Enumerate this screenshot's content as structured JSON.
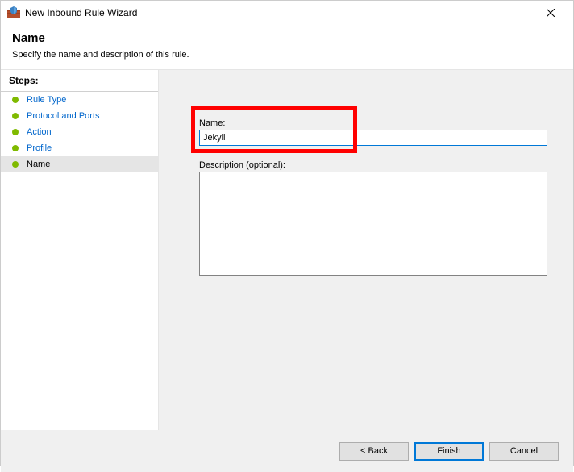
{
  "window": {
    "title": "New Inbound Rule Wizard"
  },
  "header": {
    "title": "Name",
    "subtitle": "Specify the name and description of this rule."
  },
  "sidebar": {
    "header": "Steps:",
    "items": [
      {
        "label": "Rule Type"
      },
      {
        "label": "Protocol and Ports"
      },
      {
        "label": "Action"
      },
      {
        "label": "Profile"
      },
      {
        "label": "Name"
      }
    ]
  },
  "form": {
    "name_label": "Name:",
    "name_value": "Jekyll",
    "desc_label": "Description (optional):",
    "desc_value": ""
  },
  "buttons": {
    "back": "< Back",
    "finish": "Finish",
    "cancel": "Cancel"
  }
}
